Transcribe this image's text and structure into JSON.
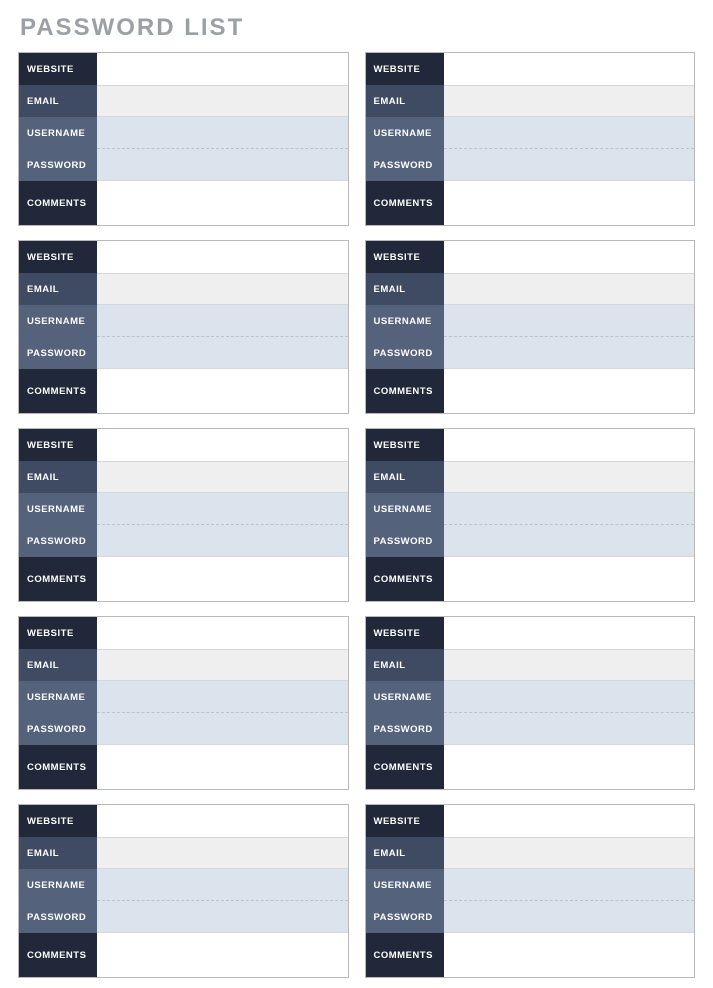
{
  "title": "PASSWORD LIST",
  "labels": {
    "website": "WEBSITE",
    "email": "EMAIL",
    "username": "USERNAME",
    "password": "PASSWORD",
    "comments": "COMMENTS"
  },
  "cards": [
    {
      "website": "",
      "email": "",
      "username": "",
      "password": "",
      "comments": ""
    },
    {
      "website": "",
      "email": "",
      "username": "",
      "password": "",
      "comments": ""
    },
    {
      "website": "",
      "email": "",
      "username": "",
      "password": "",
      "comments": ""
    },
    {
      "website": "",
      "email": "",
      "username": "",
      "password": "",
      "comments": ""
    },
    {
      "website": "",
      "email": "",
      "username": "",
      "password": "",
      "comments": ""
    },
    {
      "website": "",
      "email": "",
      "username": "",
      "password": "",
      "comments": ""
    },
    {
      "website": "",
      "email": "",
      "username": "",
      "password": "",
      "comments": ""
    },
    {
      "website": "",
      "email": "",
      "username": "",
      "password": "",
      "comments": ""
    },
    {
      "website": "",
      "email": "",
      "username": "",
      "password": "",
      "comments": ""
    },
    {
      "website": "",
      "email": "",
      "username": "",
      "password": "",
      "comments": ""
    }
  ]
}
